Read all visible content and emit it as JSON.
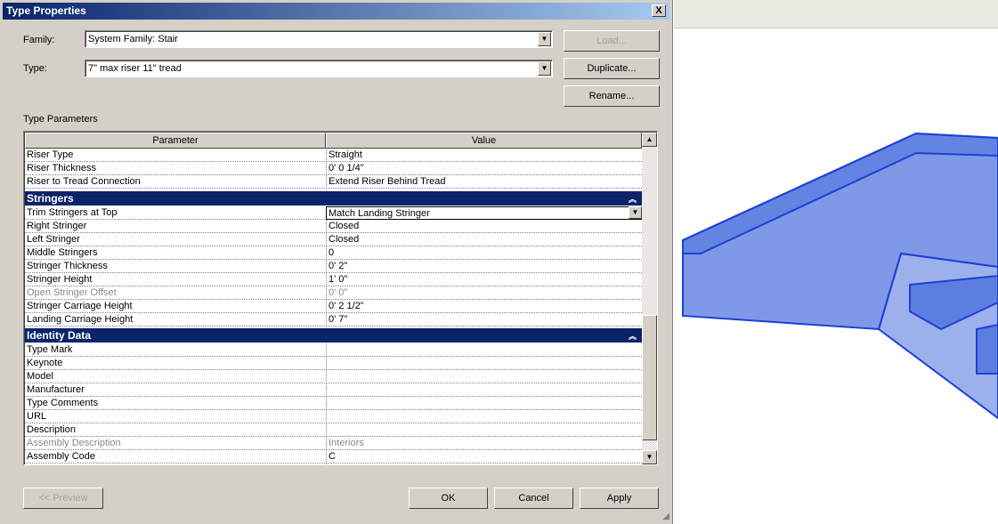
{
  "dialog": {
    "title": "Type Properties",
    "close": "X",
    "family_label": "Family:",
    "family_value": "System Family: Stair",
    "type_label": "Type:",
    "type_value": "7\" max riser 11\" tread",
    "load": "Load...",
    "duplicate": "Duplicate...",
    "rename": "Rename...",
    "type_parameters": "Type Parameters",
    "col_parameter": "Parameter",
    "col_value": "Value",
    "rows_a": [
      [
        "Riser Type",
        "Straight"
      ],
      [
        "Riser Thickness",
        "0'  0 1/4\""
      ],
      [
        "Riser to Tread Connection",
        "Extend Riser Behind Tread"
      ]
    ],
    "group_stringers": "Stringers",
    "rows_b": [
      [
        "Trim Stringers at Top",
        "Match Landing Stringer"
      ],
      [
        "Right Stringer",
        "Closed"
      ],
      [
        "Left Stringer",
        "Closed"
      ],
      [
        "Middle Stringers",
        "0"
      ],
      [
        "Stringer Thickness",
        "0'  2\""
      ],
      [
        "Stringer Height",
        "1'  0\""
      ],
      [
        "Open Stringer Offset",
        "0'  0\""
      ],
      [
        "Stringer Carriage Height",
        "0'  2 1/2\""
      ],
      [
        "Landing Carriage Height",
        "0'  7\""
      ]
    ],
    "group_identity": "Identity Data",
    "rows_c": [
      [
        "Type Mark",
        ""
      ],
      [
        "Keynote",
        ""
      ],
      [
        "Model",
        ""
      ],
      [
        "Manufacturer",
        ""
      ],
      [
        "Type Comments",
        ""
      ],
      [
        "URL",
        ""
      ],
      [
        "Description",
        ""
      ],
      [
        "Assembly Description",
        "Interiors"
      ],
      [
        "Assembly Code",
        "C"
      ]
    ],
    "preview": "<< Preview",
    "ok": "OK",
    "cancel": "Cancel",
    "apply": "Apply"
  },
  "colors": {
    "title_start": "#0a246a",
    "title_end": "#a6caf0",
    "group_bg": "#0a246a",
    "model_blue": "#1f4fd6"
  }
}
